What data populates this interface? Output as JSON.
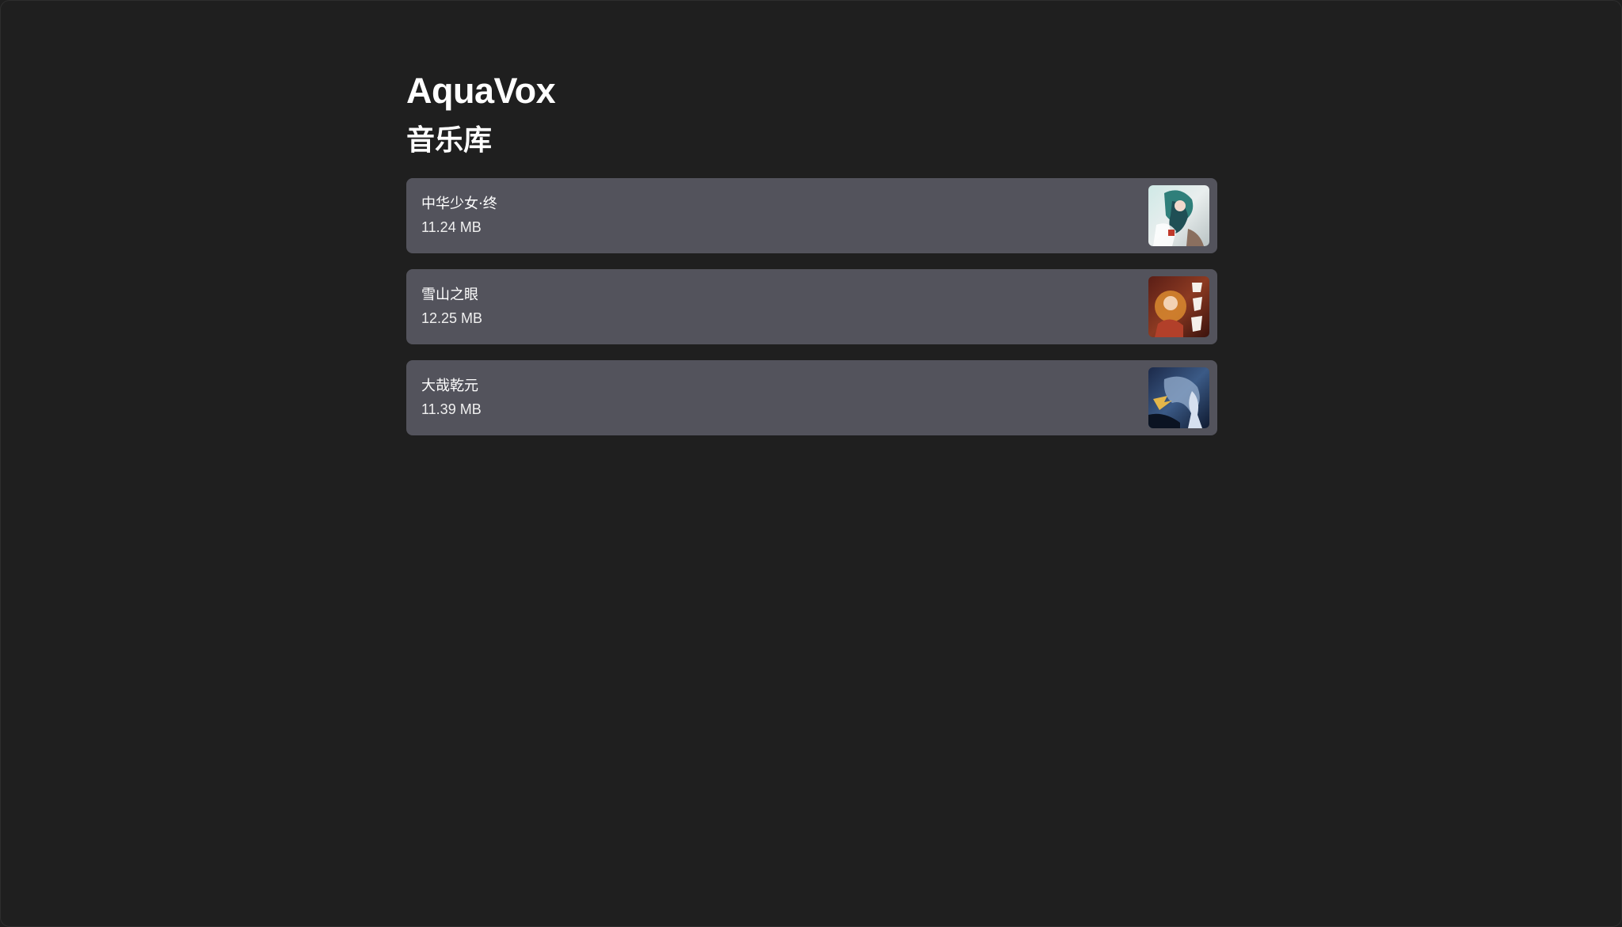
{
  "app": {
    "title": "AquaVox"
  },
  "library": {
    "heading": "音乐库",
    "tracks": [
      {
        "title": "中华少女·终",
        "size": "11.24 MB",
        "cover_icon": "album-cover-image"
      },
      {
        "title": "雪山之眼",
        "size": "12.25 MB",
        "cover_icon": "album-cover-image"
      },
      {
        "title": "大哉乾元",
        "size": "11.39 MB",
        "cover_icon": "album-cover-image"
      }
    ]
  },
  "colors": {
    "background": "#1f1f1f",
    "card": "#53535c",
    "text": "#ffffff"
  }
}
